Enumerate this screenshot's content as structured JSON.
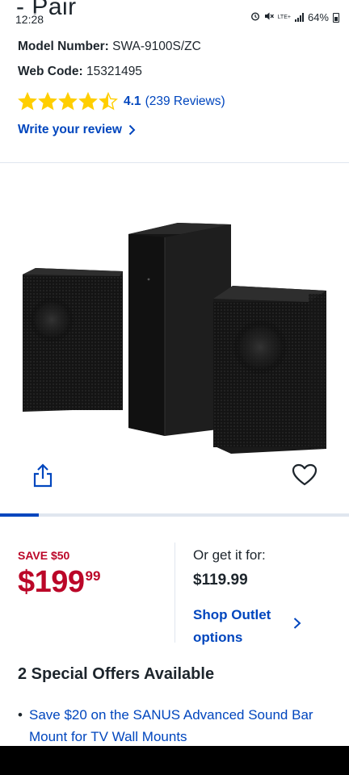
{
  "status_bar": {
    "title_fragment": "- Pair",
    "time": "12:28",
    "network": "LTE+",
    "battery": "64%"
  },
  "product": {
    "model_label": "Model Number:",
    "model_value": "SWA-9100S/ZC",
    "web_label": "Web Code:",
    "web_value": "15321495",
    "rating_value": 4.1,
    "rating_score": "4.1",
    "rating_count": "(239 Reviews)",
    "write_review": "Write your review"
  },
  "gallery": {
    "current_index": 1,
    "progress_fraction": 0.11
  },
  "pricing": {
    "save_badge": "SAVE $50",
    "price_dollars": "$199",
    "price_cents": "99",
    "alt_label": "Or get it for:",
    "alt_price": "$119.99",
    "shop_outlet": "Shop Outlet options"
  },
  "offers": {
    "title": "2 Special Offers Available",
    "items": [
      {
        "text": "Save $20 on the SANUS Advanced Sound Bar Mount for TV Wall Mounts"
      }
    ]
  },
  "colors": {
    "link_blue": "#0046be",
    "sale_red": "#bb0628",
    "star_yellow": "#ffce00",
    "text_dark": "#1d252c",
    "divider": "#e0e6ef"
  },
  "icons": {
    "rating": "star-icon",
    "review_chevron": "chevron-right-icon",
    "share": "share-icon",
    "wishlist": "heart-icon",
    "outlet_chevron": "chevron-right-icon"
  }
}
